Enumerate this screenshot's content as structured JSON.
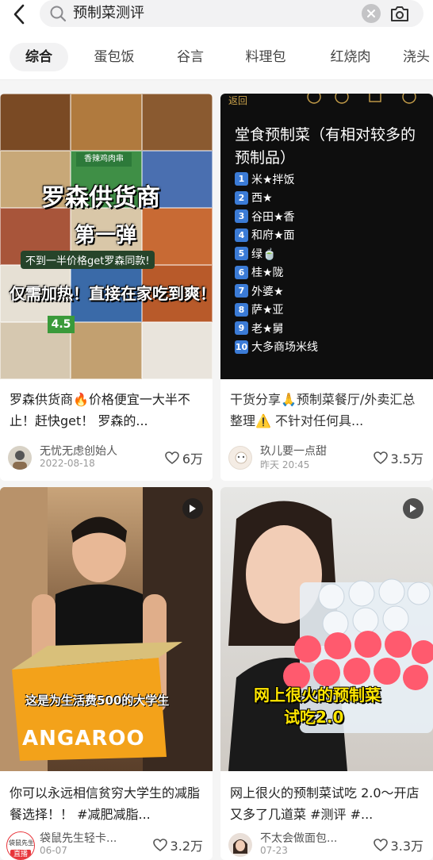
{
  "search": {
    "query": "预制菜测评"
  },
  "tabs": [
    "综合",
    "蛋包饭",
    "谷言",
    "料理包",
    "红烧肉",
    "浇头"
  ],
  "active_tab_index": 0,
  "cards": [
    {
      "caption": "罗森供货商🔥价格便宜一大半不止！赶快get！ 罗森的...",
      "author": "无忧无虑创始人",
      "date": "2022-08-18",
      "likes": "6万",
      "image_text": {
        "title": "罗森供货商",
        "subtitle": "第一弹",
        "banner": "不到一半价格get罗森同款!",
        "bottom": "仅需加热！直接在家吃到爽！",
        "label_tl": "香辣鸡肉串",
        "price": "4.5"
      }
    },
    {
      "caption": "干货分享🙏预制菜餐厅/外卖汇总整理⚠️ 不针对任何具...",
      "author": "玖儿要一点甜",
      "date": "昨天 20:45",
      "likes": "3.5万",
      "image_text": {
        "back_label": "返回",
        "heading": "堂食预制菜（有相对较多的预制品）",
        "items": [
          "米★拌饭",
          "西★",
          "谷田★香",
          "和府★面",
          "绿🍵",
          "桂★陇",
          "外婆★",
          "萨★亚",
          "老★舅",
          "大多商场米线"
        ]
      }
    },
    {
      "caption": "你可以永远相信贫穷大学生的减脂餐选择！！ #减肥减脂...",
      "author": "袋鼠先生轻卡...",
      "date": "06-07",
      "likes": "3.2万",
      "avatar_text": "袋鼠先生",
      "live_badge": "直播",
      "image_text": {
        "subtitle": "这是为生活费500的大学生",
        "box_brand": "ANGAROO"
      }
    },
    {
      "caption": "网上很火的预制菜试吃 2.0～开店又多了几道菜 #测评 #...",
      "author": "不太会做面包...",
      "date": "07-23",
      "likes": "3.3万",
      "image_text": {
        "title_line1": "网上很火的预制菜",
        "title_line2": "试吃2.0"
      }
    }
  ],
  "colors": {
    "accent_blue": "#3b7bd6",
    "tab_active_bg": "#f2f2f3",
    "overlay_yellow": "#ffe600",
    "live_red": "#e8343a"
  }
}
